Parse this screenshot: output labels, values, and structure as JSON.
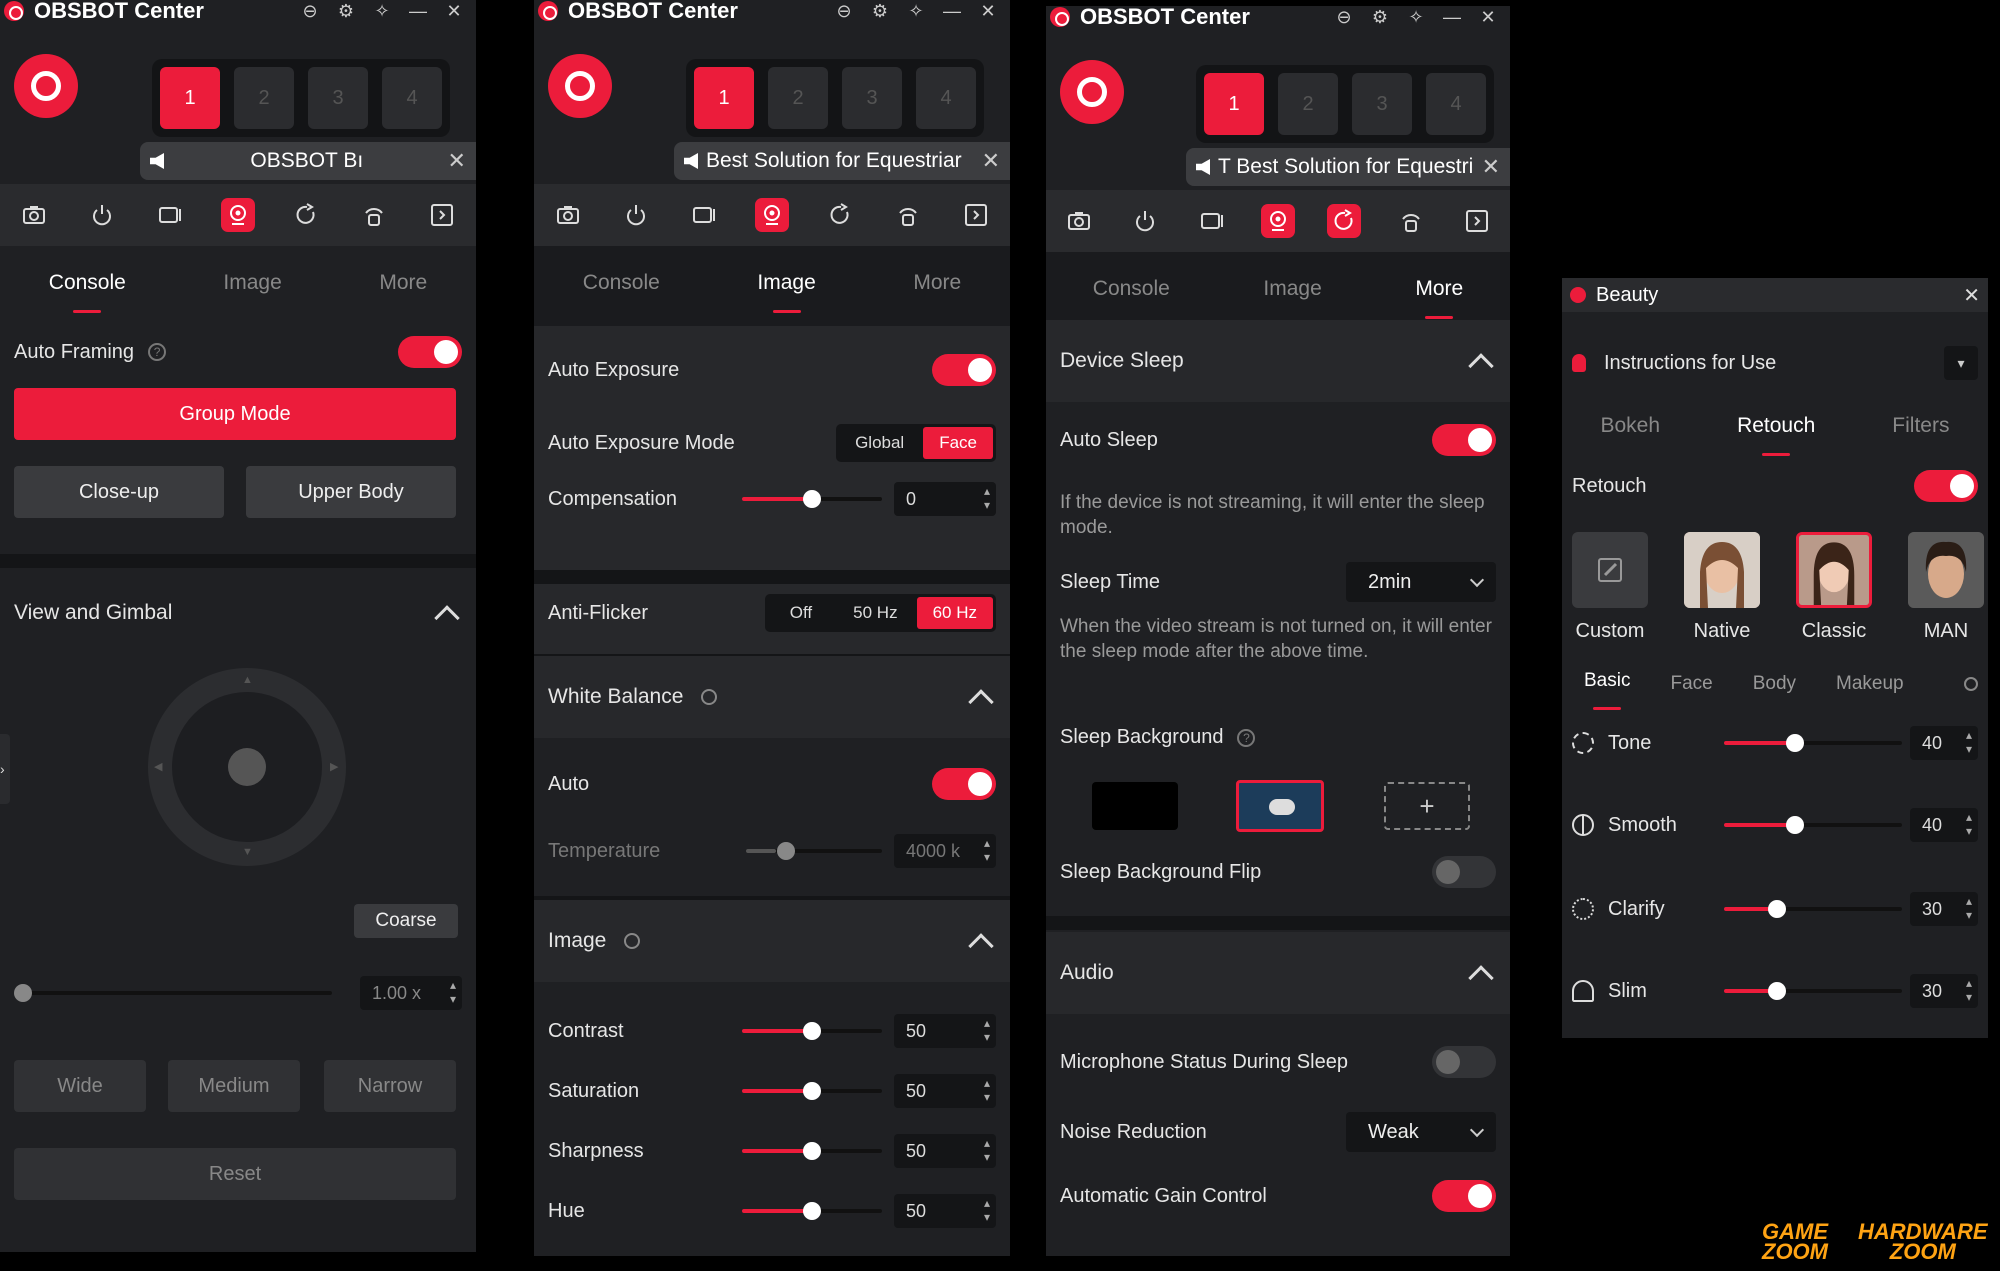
{
  "app_title": "OBSBOT Center",
  "camera_slots": [
    "1",
    "2",
    "3",
    "4"
  ],
  "toolbar_icons": [
    "camera-icon",
    "power-icon",
    "record-icon",
    "webcam-icon",
    "rotate-icon",
    "tracking-icon",
    "collapse-icon"
  ],
  "tabs": [
    "Console",
    "Image",
    "More"
  ],
  "panel1": {
    "device_name": "OBSBOT Bı",
    "auto_framing": "Auto Framing",
    "group_mode": "Group Mode",
    "close_up": "Close-up",
    "upper_body": "Upper Body",
    "view_gimbal": "View and Gimbal",
    "coarse": "Coarse",
    "zoom_value": "1.00 x",
    "wide": "Wide",
    "medium": "Medium",
    "narrow": "Narrow",
    "reset": "Reset"
  },
  "panel2": {
    "device_name": "Best Solution for Equestriar",
    "auto_exposure": "Auto Exposure",
    "auto_exposure_mode": "Auto Exposure Mode",
    "mode_global": "Global",
    "mode_face": "Face",
    "compensation": "Compensation",
    "compensation_value": "0",
    "compensation_level": 0.5,
    "anti_flicker": "Anti-Flicker",
    "flicker_off": "Off",
    "flicker_50": "50 Hz",
    "flicker_60": "60 Hz",
    "white_balance": "White Balance",
    "auto": "Auto",
    "temperature": "Temperature",
    "temperature_value": "4000 k",
    "image_section": "Image",
    "contrast": "Contrast",
    "contrast_value": "50",
    "saturation": "Saturation",
    "saturation_value": "50",
    "sharpness": "Sharpness",
    "sharpness_value": "50",
    "hue": "Hue",
    "hue_value": "50"
  },
  "panel3": {
    "device_name": "T Best Solution for Equestri",
    "device_sleep": "Device Sleep",
    "auto_sleep": "Auto Sleep",
    "auto_sleep_desc": "If the device is not streaming, it will enter the sleep mode.",
    "sleep_time": "Sleep Time",
    "sleep_time_value": "2min",
    "sleep_time_desc": "When the video stream is not turned on, it will enter the sleep mode after the above time.",
    "sleep_background": "Sleep Background",
    "add_symbol": "+",
    "sleep_bg_flip": "Sleep Background Flip",
    "audio": "Audio",
    "mic_status": "Microphone Status During Sleep",
    "noise_reduction": "Noise Reduction",
    "noise_value": "Weak",
    "agc": "Automatic Gain Control"
  },
  "beauty": {
    "title": "Beauty",
    "instructions": "Instructions for Use",
    "tabs": [
      "Bokeh",
      "Retouch",
      "Filters"
    ],
    "retouch": "Retouch",
    "presets": [
      "Custom",
      "Native",
      "Classic",
      "MAN"
    ],
    "subtabs": [
      "Basic",
      "Face",
      "Body",
      "Makeup"
    ],
    "tone": "Tone",
    "tone_value": "40",
    "smooth": "Smooth",
    "smooth_value": "40",
    "clarify": "Clarify",
    "clarify_value": "30",
    "slim": "Slim",
    "slim_value": "30"
  },
  "watermark": {
    "game": "GAME",
    "zoom1": "ZOOM",
    "hardware": "HARDWARE",
    "zoom2": "ZOOM"
  },
  "colors": {
    "accent": "#ec1c3b",
    "panel": "#1f2023",
    "watermark": "#ffa313"
  }
}
